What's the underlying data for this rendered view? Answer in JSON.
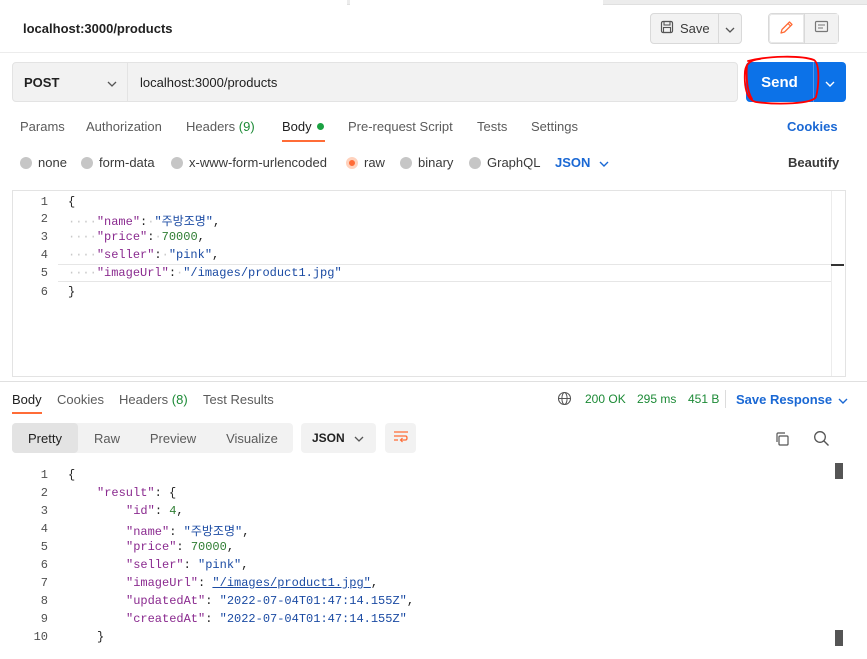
{
  "header": {
    "title": "localhost:3000/products",
    "save_label": "Save"
  },
  "request": {
    "method": "POST",
    "url": "localhost:3000/products",
    "send_label": "Send"
  },
  "request_tabs": [
    {
      "label": "Params"
    },
    {
      "label": "Authorization"
    },
    {
      "label": "Headers",
      "count": "(9)"
    },
    {
      "label": "Body"
    },
    {
      "label": "Pre-request Script"
    },
    {
      "label": "Tests"
    },
    {
      "label": "Settings"
    }
  ],
  "cookies_label": "Cookies",
  "body_types": [
    {
      "label": "none"
    },
    {
      "label": "form-data"
    },
    {
      "label": "x-www-form-urlencoded"
    },
    {
      "label": "raw"
    },
    {
      "label": "binary"
    },
    {
      "label": "GraphQL"
    }
  ],
  "body_format": "JSON",
  "beautify_label": "Beautify",
  "request_body": {
    "line_numbers": [
      "1",
      "2",
      "3",
      "4",
      "5",
      "6"
    ],
    "open": "{",
    "close": "}",
    "fields": [
      {
        "key": "\"name\"",
        "value": "\"주방조명\"",
        "kind": "str",
        "comma": ","
      },
      {
        "key": "\"price\"",
        "value": "70000",
        "kind": "num",
        "comma": ","
      },
      {
        "key": "\"seller\"",
        "value": "\"pink\"",
        "kind": "str",
        "comma": ","
      },
      {
        "key": "\"imageUrl\"",
        "value": "\"/images/product1.jpg\"",
        "kind": "str",
        "comma": ""
      }
    ]
  },
  "response_tabs": [
    {
      "label": "Body"
    },
    {
      "label": "Cookies"
    },
    {
      "label": "Headers",
      "count": "(8)"
    },
    {
      "label": "Test Results"
    }
  ],
  "response_status": {
    "status": "200 OK",
    "time": "295 ms",
    "size": "451 B",
    "save_label": "Save Response"
  },
  "view_modes": [
    {
      "label": "Pretty"
    },
    {
      "label": "Raw"
    },
    {
      "label": "Preview"
    },
    {
      "label": "Visualize"
    }
  ],
  "response_format": "JSON",
  "response_body": {
    "line_numbers": [
      "1",
      "2",
      "3",
      "4",
      "5",
      "6",
      "7",
      "8",
      "9",
      "10"
    ],
    "open": "{",
    "result_key": "\"result\"",
    "result_open": "{",
    "result_close": "}",
    "fields": [
      {
        "key": "\"id\"",
        "value": "4",
        "kind": "num",
        "comma": ","
      },
      {
        "key": "\"name\"",
        "value": "\"주방조명\"",
        "kind": "str",
        "comma": ","
      },
      {
        "key": "\"price\"",
        "value": "70000",
        "kind": "num",
        "comma": ","
      },
      {
        "key": "\"seller\"",
        "value": "\"pink\"",
        "kind": "str",
        "comma": ","
      },
      {
        "key": "\"imageUrl\"",
        "value": "\"/images/product1.jpg\"",
        "kind": "link",
        "comma": ","
      },
      {
        "key": "\"updatedAt\"",
        "value": "\"2022-07-04T01:47:14.155Z\"",
        "kind": "str",
        "comma": ","
      },
      {
        "key": "\"createdAt\"",
        "value": "\"2022-07-04T01:47:14.155Z\"",
        "kind": "str",
        "comma": ""
      }
    ]
  },
  "colors": {
    "accent": "#ff6c37",
    "send": "#0c72e8",
    "link": "#1a68d4",
    "status_ok": "#1c8a36",
    "annotation": "#ff0000"
  },
  "icons": [
    "save-icon",
    "chevron-down-icon",
    "pencil-icon",
    "document-icon",
    "globe-icon",
    "wrap-lines-icon",
    "copy-icon",
    "search-icon"
  ]
}
